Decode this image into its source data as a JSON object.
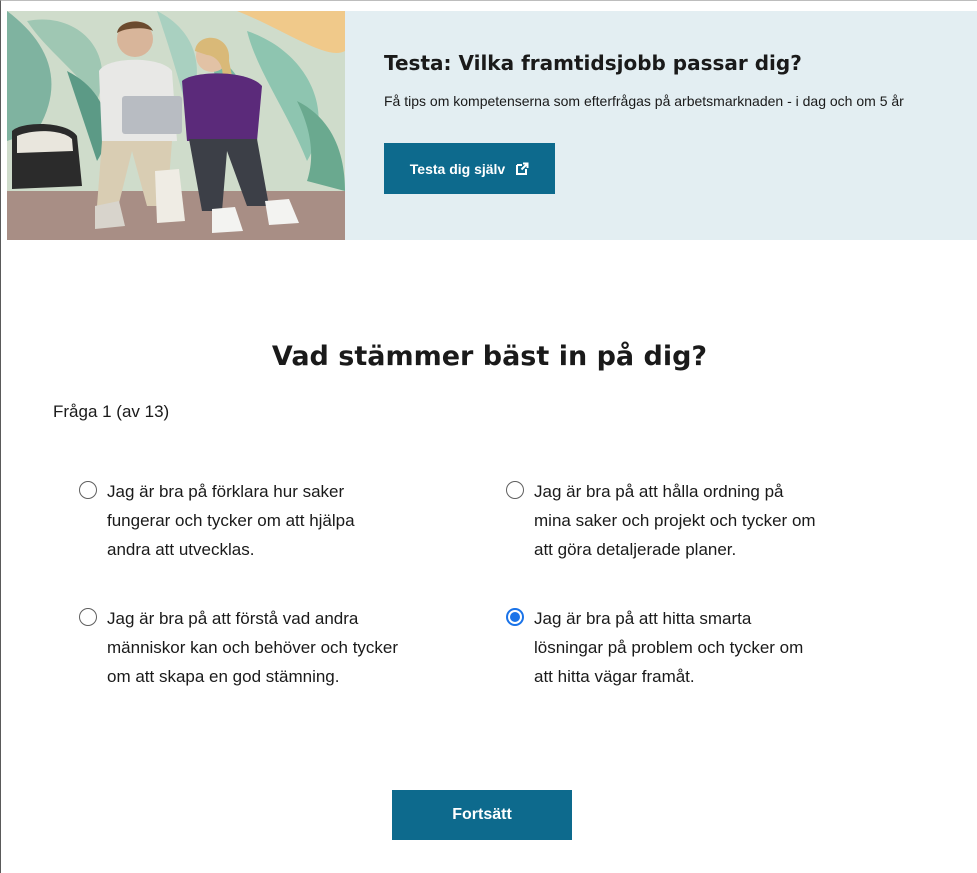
{
  "banner": {
    "title": "Testa: Vilka framtidsjobb passar dig?",
    "description": "Få tips om kompetenserna som efterfrågas på arbetsmarknaden - i dag och om 5 år",
    "button_label": "Testa dig själv",
    "button_icon": "external-link-icon",
    "accent_color": "#0d6a8d",
    "background_color": "#e3eef2"
  },
  "quiz": {
    "title": "Vad stämmer bäst in på dig?",
    "progress": "Fråga 1 (av 13)",
    "options": [
      {
        "label": "Jag är bra på förklara hur saker fungerar och tycker om att hjälpa andra att utvecklas.",
        "selected": false
      },
      {
        "label": "Jag är bra på att hålla ordning på mina saker och projekt och tycker om att göra detaljerade planer.",
        "selected": false
      },
      {
        "label": "Jag är bra på att förstå vad andra människor kan och behöver och tycker om att skapa en god stämning.",
        "selected": false
      },
      {
        "label": "Jag är bra på att hitta smarta lösningar på problem och tycker om att hitta vägar framåt.",
        "selected": true
      }
    ],
    "continue_label": "Fortsätt",
    "selected_color": "#1a73e8"
  }
}
